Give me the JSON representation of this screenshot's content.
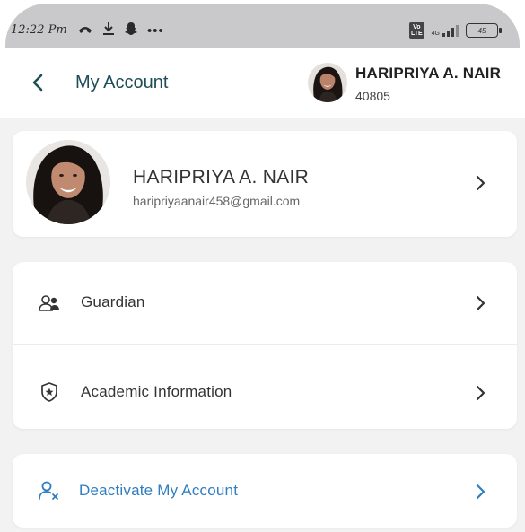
{
  "status_bar": {
    "time": "12:22 Pm",
    "overflow": "•••",
    "network_label": "Vo LTE",
    "network_sub": "4G",
    "battery": "45"
  },
  "header": {
    "title": "My Account",
    "user_name": "HARIPRIYA A. NAIR",
    "user_id": "40805"
  },
  "profile": {
    "name": "HARIPRIYA A. NAIR",
    "email": "haripriyaanair458@gmail.com"
  },
  "menu": {
    "items": [
      {
        "label": "Guardian",
        "icon": "guardian-icon"
      },
      {
        "label": "Academic Information",
        "icon": "shield-star-icon"
      }
    ]
  },
  "deactivate": {
    "label": "Deactivate My Account",
    "icon": "user-remove-icon"
  },
  "colors": {
    "title": "#1d4e57",
    "link": "#2f7ec2",
    "background": "#f2f2f3"
  }
}
